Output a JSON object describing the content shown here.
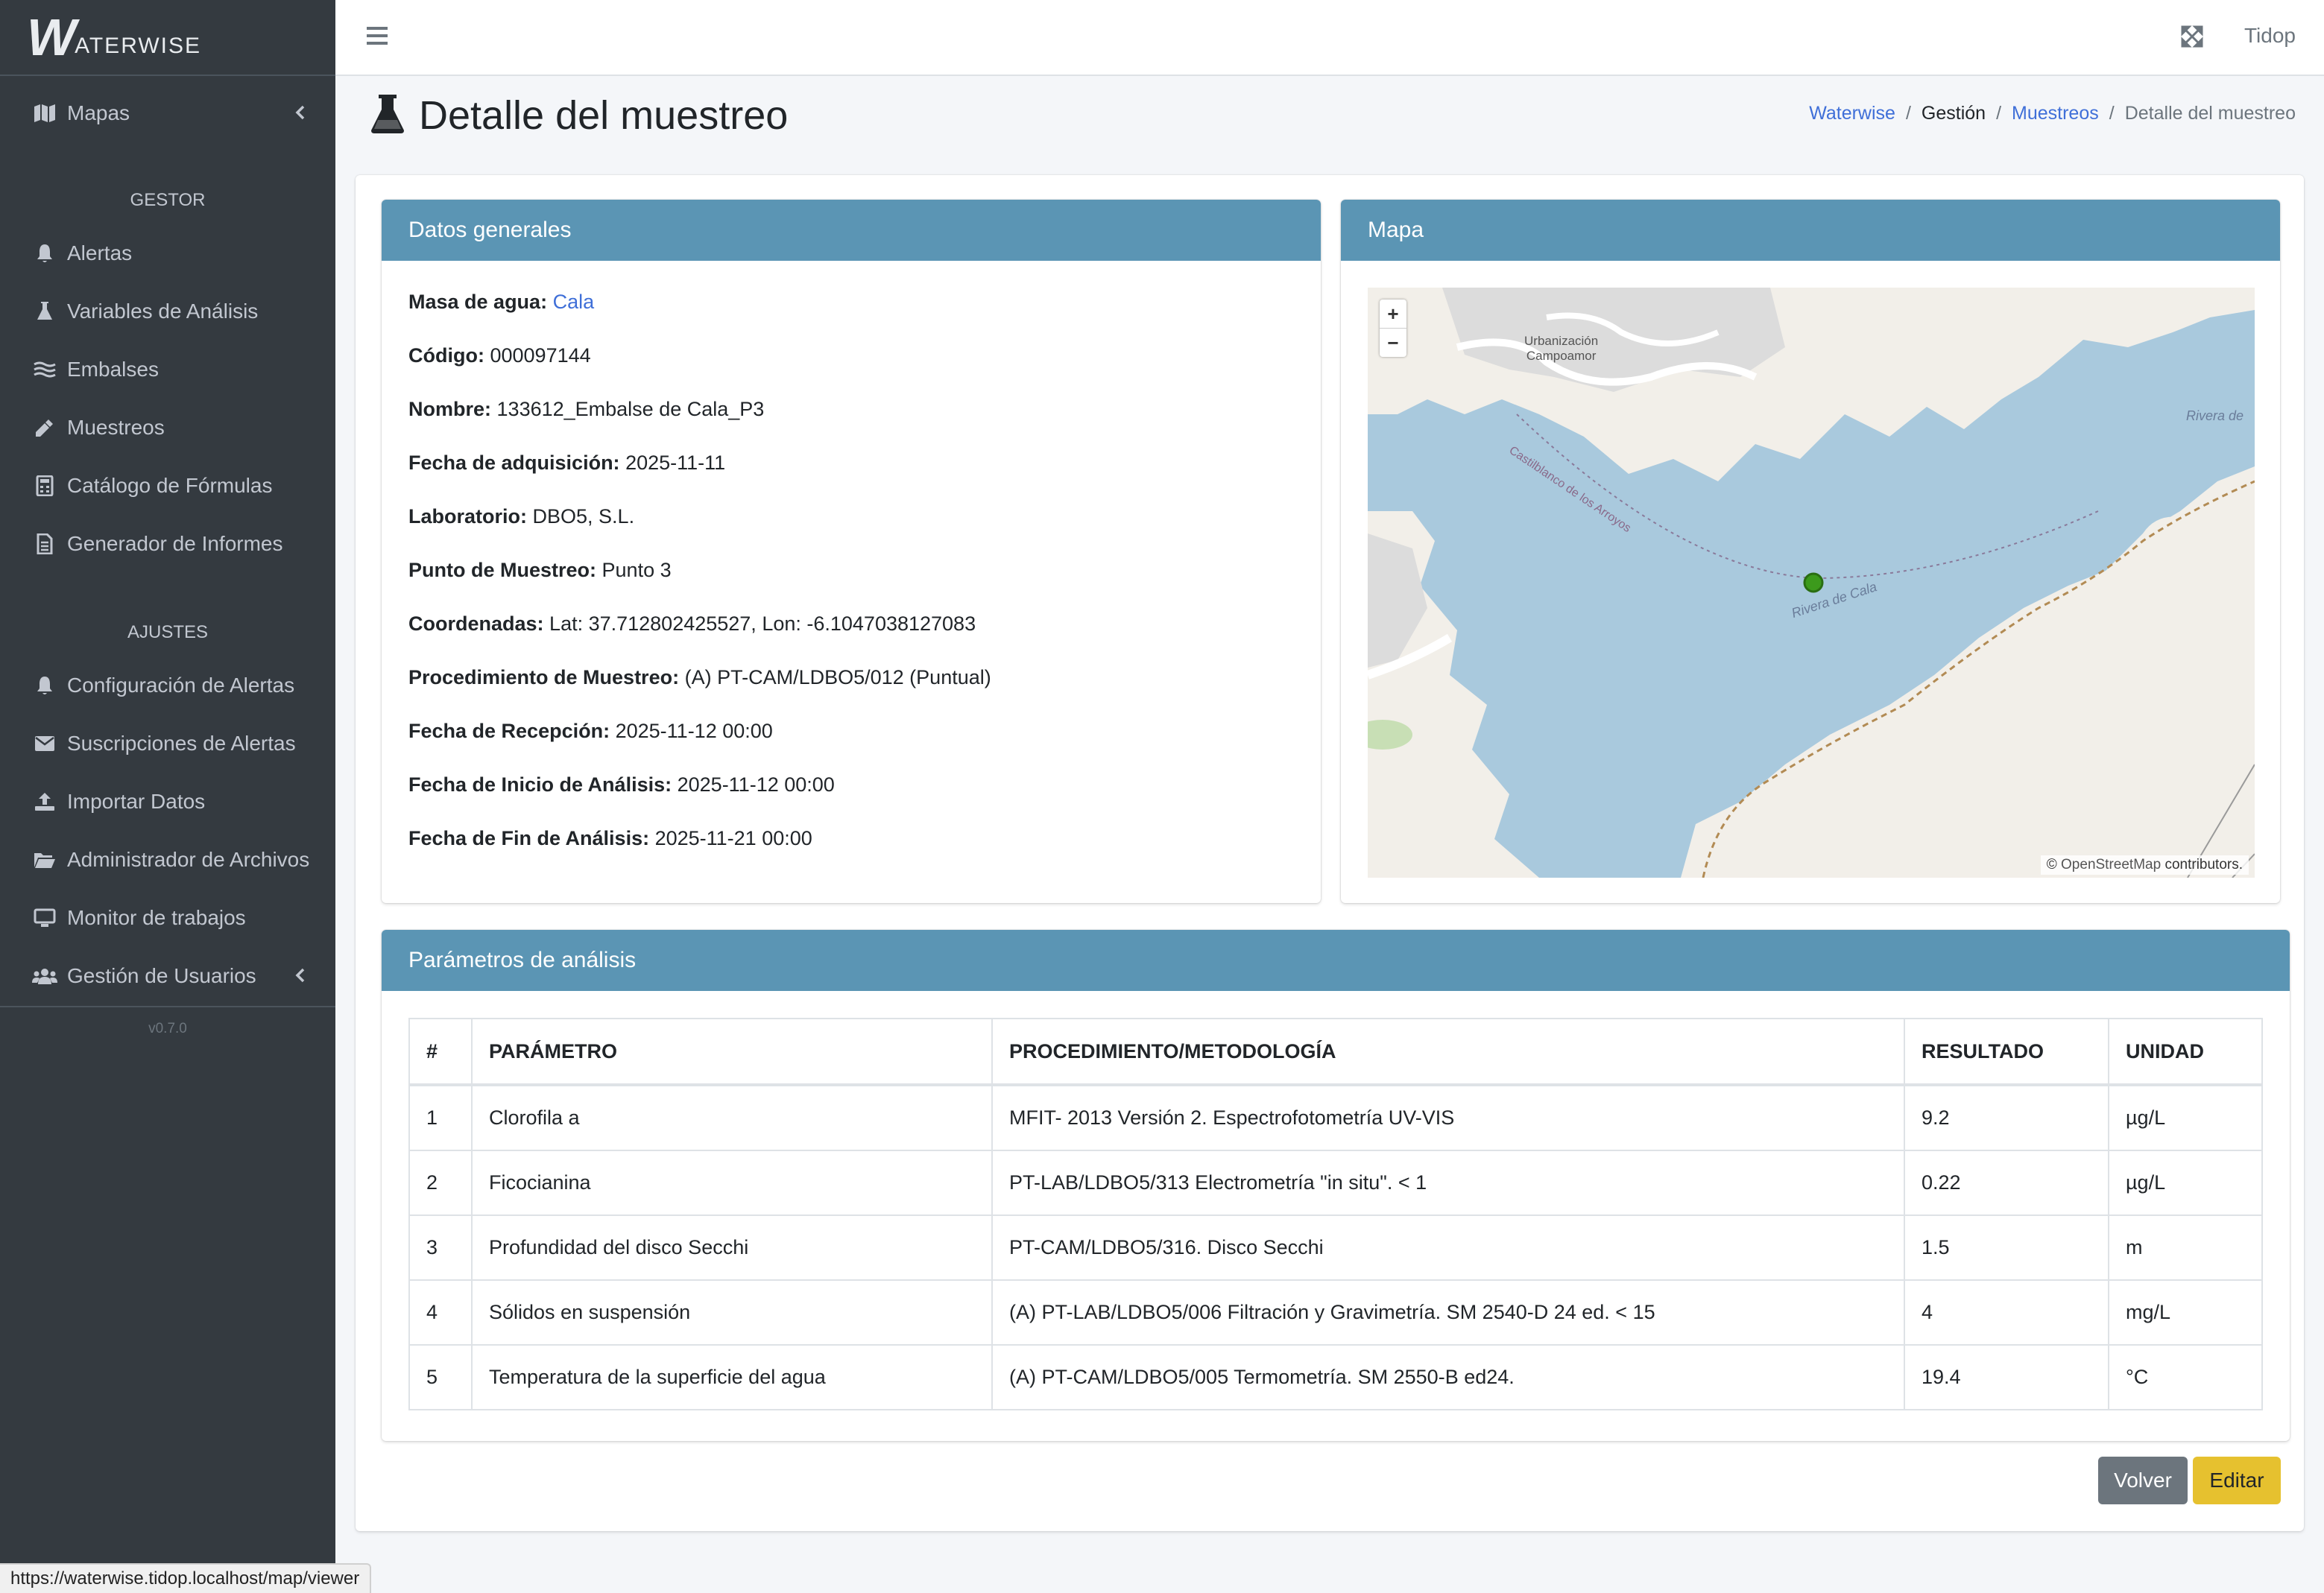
{
  "brand": {
    "logo_letter": "W",
    "logo_text": "ATERWISE"
  },
  "sidebar": {
    "maps": "Mapas",
    "section_gestor": "GESTOR",
    "gestor_items": [
      "Alertas",
      "Variables de Análisis",
      "Embalses",
      "Muestreos",
      "Catálogo de Fórmulas",
      "Generador de Informes"
    ],
    "section_ajustes": "AJUSTES",
    "ajustes_items": [
      "Configuración de Alertas",
      "Suscripciones de Alertas",
      "Importar Datos",
      "Administrador de Archivos",
      "Monitor de trabajos",
      "Gestión de Usuarios"
    ],
    "version": "v0.7.0"
  },
  "navbar": {
    "user": "Tidop"
  },
  "page": {
    "title": "Detalle del muestreo"
  },
  "breadcrumb": [
    "Waterwise",
    "Gestión",
    "Muestreos",
    "Detalle del muestreo"
  ],
  "general": {
    "header": "Datos generales",
    "fields": [
      {
        "label": "Masa de agua:",
        "value": "Cala"
      },
      {
        "label": "Código:",
        "value": "000097144"
      },
      {
        "label": "Nombre:",
        "value": "133612_Embalse de Cala_P3"
      },
      {
        "label": "Fecha de adquisición:",
        "value": "2025-11-11"
      },
      {
        "label": "Laboratorio:",
        "value": "DBO5, S.L."
      },
      {
        "label": "Punto de Muestreo:",
        "value": "Punto 3"
      },
      {
        "label": "Coordenadas:",
        "value": "Lat: 37.712802425527, Lon: -6.1047038127083"
      },
      {
        "label": "Procedimiento de Muestreo:",
        "value": "(A) PT-CAM/LDBO5/012 (Puntual)"
      },
      {
        "label": "Fecha de Recepción:",
        "value": "2025-11-12 00:00"
      },
      {
        "label": "Fecha de Inicio de Análisis:",
        "value": "2025-11-12 00:00"
      },
      {
        "label": "Fecha de Fin de Análisis:",
        "value": "2025-11-21 00:00"
      }
    ]
  },
  "map": {
    "header": "Mapa",
    "zoom_in": "+",
    "zoom_out": "−",
    "labels": {
      "urbanizacion_1": "Urbanización",
      "urbanizacion_2": "Campoamor",
      "road": "Castilblanco de los Arroyos",
      "river_1": "Rivera de Cala",
      "river_2": "Rivera de"
    },
    "attribution_symbol": "©",
    "attribution_link": "OpenStreetMap",
    "attribution_text": " contributors.",
    "colors": {
      "water": "#a9c9dd",
      "land": "#f2efe9",
      "urban": "#dcdcdc",
      "marker": "#3c9a1c"
    }
  },
  "params": {
    "header": "Parámetros de análisis",
    "columns": [
      "#",
      "PARÁMETRO",
      "PROCEDIMIENTO/METODOLOGÍA",
      "RESULTADO",
      "UNIDAD"
    ],
    "rows": [
      [
        "1",
        "Clorofila a",
        "MFIT- 2013 Versión 2. Espectrofotometría UV-VIS",
        "9.2",
        "µg/L"
      ],
      [
        "2",
        "Ficocianina",
        "PT-LAB/LDBO5/313 Electrometría \"in situ\". < 1",
        "0.22",
        "µg/L"
      ],
      [
        "3",
        "Profundidad del disco Secchi",
        "PT-CAM/LDBO5/316. Disco Secchi",
        "1.5",
        "m"
      ],
      [
        "4",
        "Sólidos en suspensión",
        "(A) PT-LAB/LDBO5/006 Filtración y Gravimetría. SM 2540-D 24 ed. < 15",
        "4",
        "mg/L"
      ],
      [
        "5",
        "Temperatura de la superficie del agua",
        "(A) PT-CAM/LDBO5/005 Termometría. SM 2550-B ed24.",
        "19.4",
        "°C"
      ]
    ]
  },
  "buttons": {
    "back": "Volver",
    "edit": "Editar"
  },
  "status_url": "https://waterwise.tidop.localhost/map/viewer",
  "colors": {
    "sidebar_bg": "#343a40",
    "card_header": "#5b95b4",
    "link": "#3f6fd8",
    "edit_button": "#e6c12f",
    "back_button": "#6c757d"
  }
}
